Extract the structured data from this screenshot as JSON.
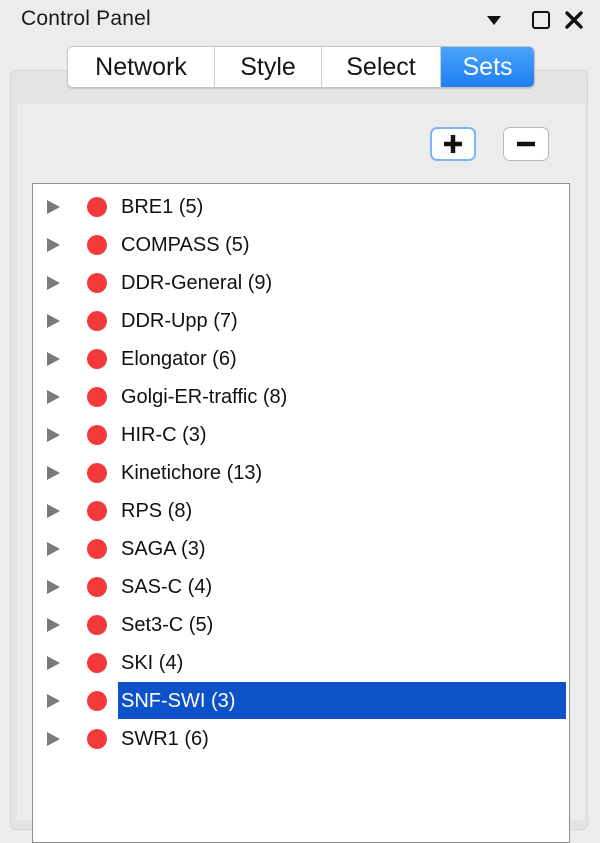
{
  "window": {
    "title": "Control Panel",
    "menu_icon": "caret-down-icon",
    "float_icon": "maximize-square-icon",
    "close_icon": "close-x-icon"
  },
  "tabs": [
    {
      "label": "Network",
      "active": false
    },
    {
      "label": "Style",
      "active": false
    },
    {
      "label": "Select",
      "active": false
    },
    {
      "label": "Sets",
      "active": true
    }
  ],
  "toolbar": {
    "add_icon": "plus-icon",
    "remove_icon": "minus-icon"
  },
  "colors": {
    "accent": "#1d7ff1",
    "selection": "#0d52c9",
    "set_dot": "#f23a3a"
  },
  "sets": [
    {
      "label": "BRE1 (5)",
      "selected": false
    },
    {
      "label": "COMPASS (5)",
      "selected": false
    },
    {
      "label": "DDR-General (9)",
      "selected": false
    },
    {
      "label": "DDR-Upp (7)",
      "selected": false
    },
    {
      "label": "Elongator (6)",
      "selected": false
    },
    {
      "label": "Golgi-ER-traffic (8)",
      "selected": false
    },
    {
      "label": "HIR-C (3)",
      "selected": false
    },
    {
      "label": "Kinetichore (13)",
      "selected": false
    },
    {
      "label": "RPS (8)",
      "selected": false
    },
    {
      "label": "SAGA (3)",
      "selected": false
    },
    {
      "label": "SAS-C (4)",
      "selected": false
    },
    {
      "label": "Set3-C (5)",
      "selected": false
    },
    {
      "label": "SKI (4)",
      "selected": false
    },
    {
      "label": "SNF-SWI (3)",
      "selected": true
    },
    {
      "label": "SWR1 (6)",
      "selected": false
    }
  ]
}
